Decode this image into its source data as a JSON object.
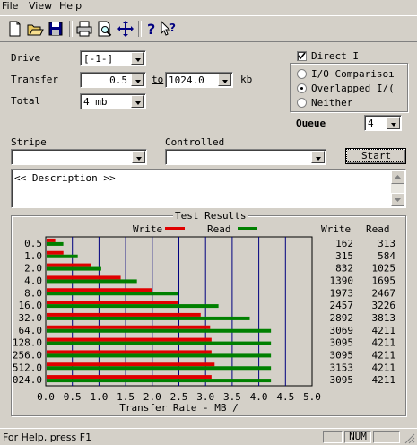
{
  "menu": [
    "File",
    "View",
    "Help"
  ],
  "toolbar": [
    {
      "icon": "new-icon"
    },
    {
      "icon": "open-icon"
    },
    {
      "icon": "save-icon"
    },
    {
      "icon": "print-icon"
    },
    {
      "icon": "print-preview-icon"
    },
    {
      "icon": "move-icon"
    },
    {
      "icon": "help-icon"
    },
    {
      "icon": "context-help-icon"
    }
  ],
  "form": {
    "drive_label": "Drive",
    "drive_value": "[-1-]",
    "transfer_label": "Transfer",
    "transfer_from": "0.5",
    "to_label": "to",
    "transfer_to": "1024.0",
    "kb_label": "kb",
    "total_label": "Total",
    "total_value": "4 mb",
    "stripe_label": "Stripe",
    "stripe_value": "",
    "controlled_label": "Controlled",
    "controlled_value": "",
    "description": "<< Description >>",
    "start_label": "Start"
  },
  "options": {
    "direct_io_label": "Direct I",
    "direct_io_checked": true,
    "io_comparison_label": "I/O Comparisoı",
    "overlapped_label": "Overlapped I/(",
    "neither_label": "Neither",
    "selected_mode": "overlapped",
    "queue_label": "Queue",
    "queue_value": "4"
  },
  "results": {
    "title": "Test Results",
    "legend_write": "Write",
    "legend_read": "Read",
    "col_write": "Write",
    "col_read": "Read"
  },
  "chart_data": {
    "type": "bar",
    "orientation": "horizontal",
    "title": "Test Results",
    "xlabel": "Transfer Rate - MB /",
    "ylabel": "",
    "xlim": [
      0,
      5.0
    ],
    "xticks": [
      "0.0",
      "0.5",
      "1.0",
      "1.5",
      "2.0",
      "2.5",
      "3.0",
      "3.5",
      "4.0",
      "4.5",
      "5.0"
    ],
    "categories": [
      "0.5",
      "1.0",
      "2.0",
      "4.0",
      "8.0",
      "16.0",
      "32.0",
      "64.0",
      "128.0",
      "256.0",
      "512.0",
      "024.0"
    ],
    "series": [
      {
        "name": "Write",
        "color": "#e00000",
        "values": [
          162,
          315,
          832,
          1390,
          1973,
          2457,
          2892,
          3069,
          3095,
          3095,
          3153,
          3095
        ]
      },
      {
        "name": "Read",
        "color": "#008000",
        "values": [
          313,
          584,
          1025,
          1695,
          2467,
          3226,
          3813,
          4211,
          4211,
          4211,
          4211,
          4211
        ]
      }
    ],
    "grid": true,
    "legend": "top"
  },
  "status": {
    "help_text": "For Help, press F1",
    "num": "NUM"
  },
  "colors": {
    "write": "#e00000",
    "read": "#008000",
    "grid": "#00007f"
  }
}
